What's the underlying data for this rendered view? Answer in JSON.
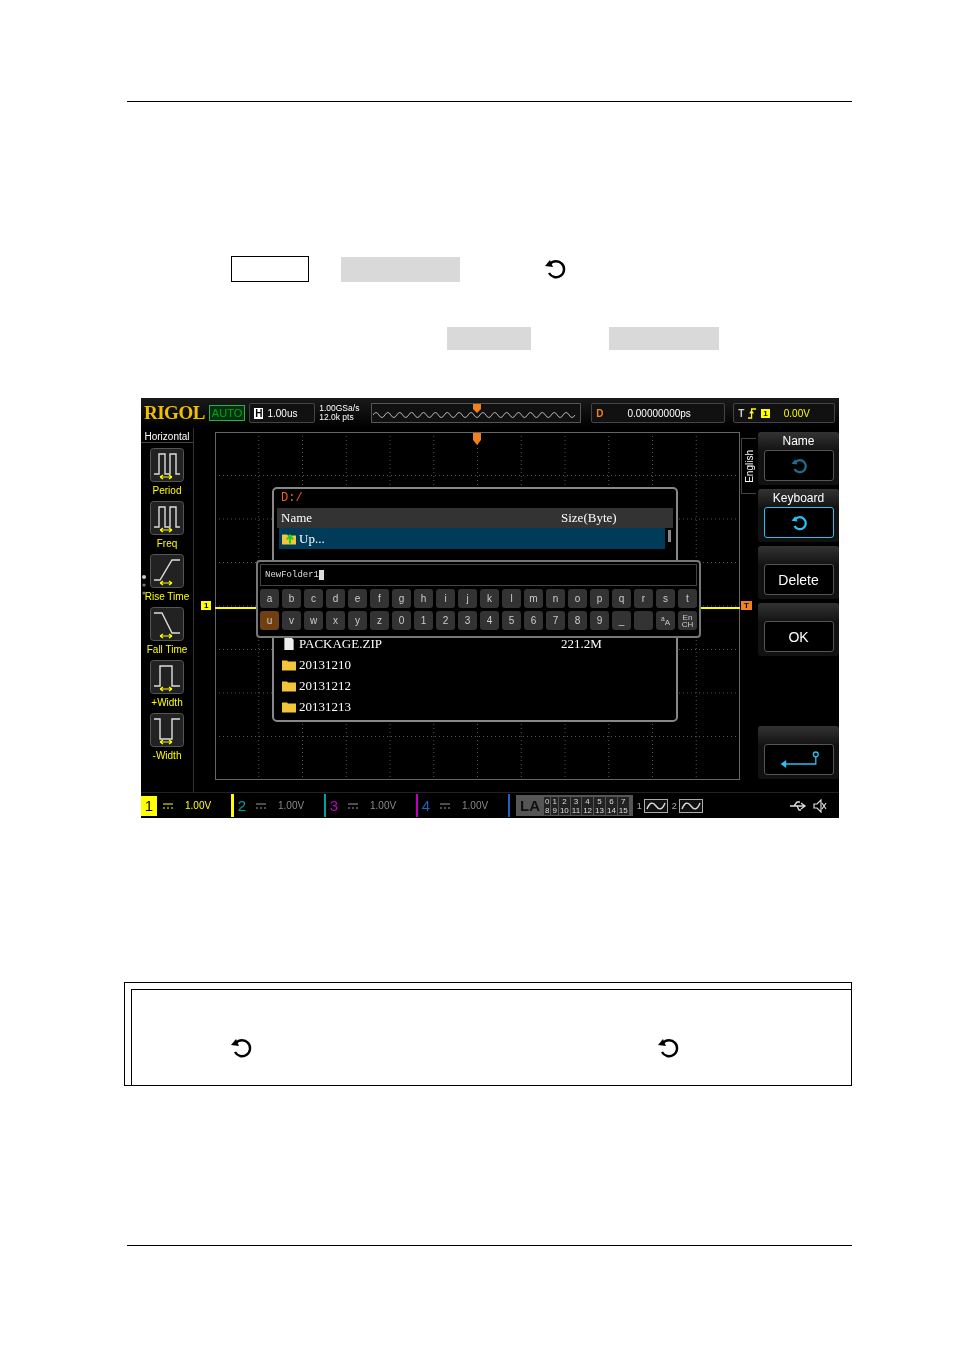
{
  "scope": {
    "top_bar": {
      "logo": "RIGOL",
      "mode": "AUTO",
      "timebase_label": "H",
      "timebase": "1.00us",
      "sample_rate": "1.00GSa/s",
      "memory_depth": "12.0k pts",
      "delay_label": "D",
      "delay": "0.00000000ps",
      "trigger_label": "T",
      "trigger_source": "1",
      "trigger_level": "0.00V"
    },
    "left_menu": {
      "title": "Horizontal",
      "items": [
        {
          "label": "Period",
          "kind": "period"
        },
        {
          "label": "Freq",
          "kind": "freq"
        },
        {
          "label": "Rise Time",
          "kind": "rise"
        },
        {
          "label": "Fall Time",
          "kind": "fall"
        },
        {
          "label": "+Width",
          "kind": "pwidth"
        },
        {
          "label": "-Width",
          "kind": "nwidth"
        }
      ]
    },
    "channel_marker": "1",
    "trigger_marker": "T",
    "file_dialog": {
      "path": "D:/",
      "columns": [
        "Name",
        "Size(Byte)"
      ],
      "rows": [
        {
          "name": "Up...",
          "kind": "up",
          "selected": true
        },
        {
          "name": "PACKAGE.ZIP",
          "size": "221.2M",
          "kind": "file",
          "selected": false
        },
        {
          "name": "20131210",
          "kind": "folder",
          "selected": false
        },
        {
          "name": "20131212",
          "kind": "folder",
          "selected": false
        },
        {
          "name": "20131213",
          "kind": "folder",
          "selected": false
        }
      ]
    },
    "keyboard": {
      "input": "NewFolder1",
      "keys": [
        {
          "label": "a",
          "selected": false
        },
        {
          "label": "b",
          "selected": false
        },
        {
          "label": "c",
          "selected": false
        },
        {
          "label": "d",
          "selected": false
        },
        {
          "label": "e",
          "selected": false
        },
        {
          "label": "f",
          "selected": false
        },
        {
          "label": "g",
          "selected": false
        },
        {
          "label": "h",
          "selected": false
        },
        {
          "label": "i",
          "selected": false
        },
        {
          "label": "j",
          "selected": false
        },
        {
          "label": "k",
          "selected": false
        },
        {
          "label": "l",
          "selected": false
        },
        {
          "label": "m",
          "selected": false
        },
        {
          "label": "n",
          "selected": false
        },
        {
          "label": "o",
          "selected": false
        },
        {
          "label": "p",
          "selected": false
        },
        {
          "label": "q",
          "selected": false
        },
        {
          "label": "r",
          "selected": false
        },
        {
          "label": "s",
          "selected": false
        },
        {
          "label": "t",
          "selected": false
        },
        {
          "label": "u",
          "selected": true
        },
        {
          "label": "v",
          "selected": false
        },
        {
          "label": "w",
          "selected": false
        },
        {
          "label": "x",
          "selected": false
        },
        {
          "label": "y",
          "selected": false
        },
        {
          "label": "z",
          "selected": false
        },
        {
          "label": "0",
          "selected": false
        },
        {
          "label": "1",
          "selected": false
        },
        {
          "label": "2",
          "selected": false
        },
        {
          "label": "3",
          "selected": false
        },
        {
          "label": "4",
          "selected": false
        },
        {
          "label": "5",
          "selected": false
        },
        {
          "label": "6",
          "selected": false
        },
        {
          "label": "7",
          "selected": false
        },
        {
          "label": "8",
          "selected": false
        },
        {
          "label": "9",
          "selected": false
        },
        {
          "label": "_",
          "selected": false
        },
        {
          "selected": false
        },
        {
          "label": "$^{a}$A",
          "selected": false
        },
        {
          "label": "En\nCH",
          "selected": false
        }
      ]
    },
    "right_menu": {
      "language": "English",
      "items": [
        {
          "label": "Name",
          "kind": "knob",
          "selected": false
        },
        {
          "label": "Keyboard",
          "kind": "knob",
          "selected": true
        },
        {
          "label": "Delete",
          "kind": "text",
          "selected": false
        },
        {
          "label": "OK",
          "kind": "text",
          "selected": false
        },
        {
          "kind": "enter",
          "selected": false
        }
      ]
    },
    "bottom_bar": {
      "channels": [
        {
          "number": "1",
          "scale": "1.00V",
          "color": "#ffff00",
          "active": true
        },
        {
          "number": "2",
          "scale": "1.00V",
          "color": "#00a0a0",
          "active": false
        },
        {
          "number": "3",
          "scale": "1.00V",
          "color": "#c000c0",
          "active": false
        },
        {
          "number": "4",
          "scale": "1.00V",
          "color": "#2060c0",
          "active": false
        }
      ],
      "la": {
        "label": "LA",
        "digits": [
          "0",
          "1",
          "2",
          "3",
          "4",
          "5",
          "6",
          "7",
          "8",
          "9",
          "10",
          "11",
          "12",
          "13",
          "14",
          "15"
        ]
      },
      "generators": [
        "1",
        "2"
      ]
    }
  }
}
